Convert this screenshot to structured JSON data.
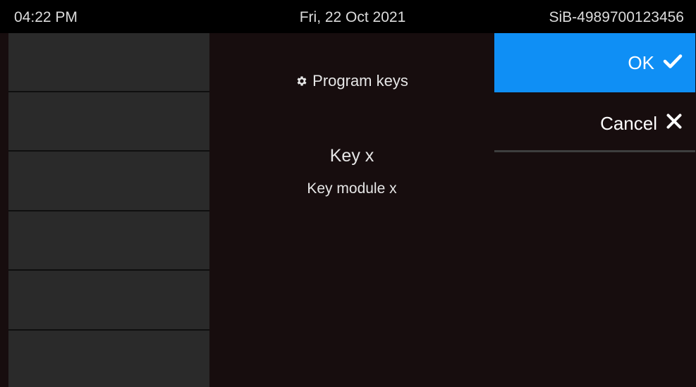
{
  "status_bar": {
    "time": "04:22 PM",
    "date": "Fri, 22 Oct 2021",
    "device_id": "SiB-4989700123456"
  },
  "center": {
    "title": "Program keys",
    "title_icon": "gear-icon",
    "key_name": "Key x",
    "key_module": "Key module x"
  },
  "actions": {
    "ok_label": "OK",
    "ok_icon": "check-icon",
    "cancel_label": "Cancel",
    "cancel_icon": "close-icon"
  },
  "colors": {
    "accent": "#0f8ff5",
    "background": "#170d0e",
    "panel": "#2a2a2a"
  }
}
